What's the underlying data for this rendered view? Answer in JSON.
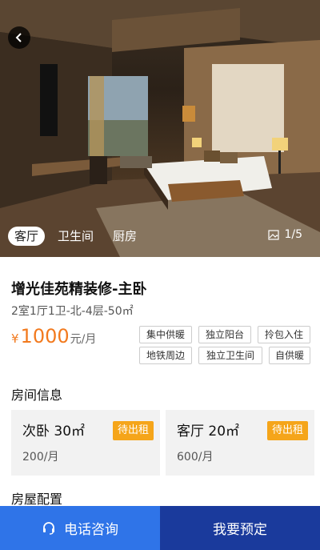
{
  "gallery": {
    "tabs": [
      "客厅",
      "卫生间",
      "厨房"
    ],
    "active_tab": "客厅",
    "counter": "1/5"
  },
  "listing": {
    "title": "增光佳苑精装修-主卧",
    "subtitle": "2室1厅1卫-北-4层-50㎡",
    "price_symbol": "¥",
    "price_value": "1000",
    "price_unit": "元/月",
    "tags": [
      "集中供暖",
      "独立阳台",
      "拎包入住",
      "地铁周边",
      "独立卫生间",
      "自供暖"
    ]
  },
  "room_info": {
    "heading": "房间信息",
    "rooms": [
      {
        "name": "次卧 30㎡",
        "price": "200/月",
        "status": "待出租"
      },
      {
        "name": "客厅 20㎡",
        "price": "600/月",
        "status": "待出租"
      }
    ]
  },
  "config": {
    "heading": "房屋配置"
  },
  "actions": {
    "call_label": "电话咨询",
    "book_label": "我要预定"
  },
  "colors": {
    "accent_orange": "#f27a1e",
    "status_badge": "#f5a51a",
    "call_btn": "#2f74e8",
    "book_btn": "#1a3a9c"
  }
}
